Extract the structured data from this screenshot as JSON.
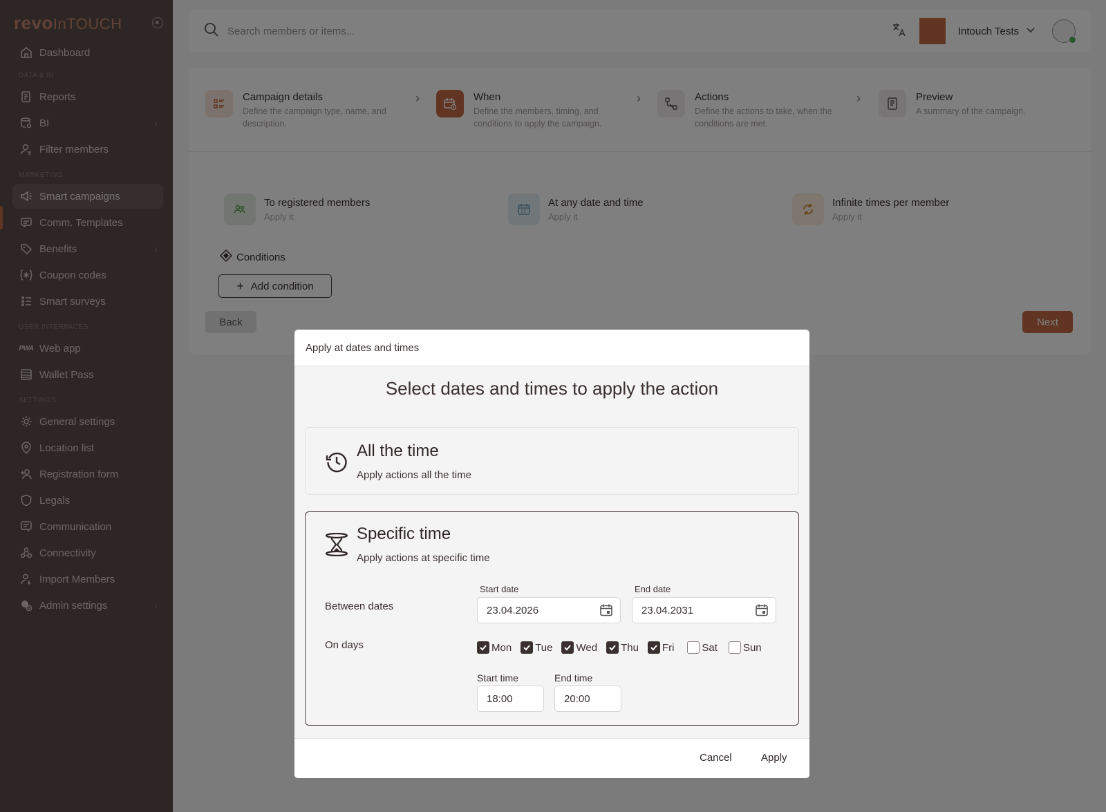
{
  "brand": {
    "logo_bold": "revo",
    "logo_light": "InTOUCH"
  },
  "sidebar": {
    "top": {
      "label": "Dashboard",
      "icon": "home-icon"
    },
    "sections": [
      {
        "title": "DATA & BI",
        "items": [
          {
            "label": "Reports",
            "icon": "reports-icon"
          },
          {
            "label": "BI",
            "icon": "bi-icon",
            "chevron": true
          },
          {
            "label": "Filter members",
            "icon": "user-filter-icon"
          }
        ]
      },
      {
        "title": "MARKETING",
        "items": [
          {
            "label": "Smart campaigns",
            "icon": "megaphone-icon",
            "active": true
          },
          {
            "label": "Comm. Templates",
            "icon": "message-icon"
          },
          {
            "label": "Benefits",
            "icon": "tag-icon",
            "chevron": true
          },
          {
            "label": "Coupon codes",
            "icon": "coupon-icon"
          },
          {
            "label": "Smart surveys",
            "icon": "survey-icon"
          }
        ]
      },
      {
        "title": "USER INTERFACES",
        "items": [
          {
            "label": "Web app",
            "icon": "pwa-icon"
          },
          {
            "label": "Wallet Pass",
            "icon": "wallet-icon"
          }
        ]
      },
      {
        "title": "SETTINGS",
        "items": [
          {
            "label": "General settings",
            "icon": "gear-icon"
          },
          {
            "label": "Location list",
            "icon": "location-pin-icon"
          },
          {
            "label": "Registration form",
            "icon": "user-add-icon"
          },
          {
            "label": "Legals",
            "icon": "shield-icon"
          },
          {
            "label": "Communication",
            "icon": "chat-icon"
          },
          {
            "label": "Connectivity",
            "icon": "connectivity-icon"
          },
          {
            "label": "Import Members",
            "icon": "import-user-icon"
          },
          {
            "label": "Admin settings",
            "icon": "admin-gear-icon",
            "chevron": true
          }
        ]
      }
    ]
  },
  "topbar": {
    "search_placeholder": "Search members or items...",
    "org_name": "Intouch Tests"
  },
  "steps": [
    {
      "title": "Campaign details",
      "desc": "Define the campaign type, name, and description.",
      "icon": "list-icon",
      "state": "done"
    },
    {
      "title": "When",
      "desc": "Define the members, timing, and conditions to apply the campaign.",
      "icon": "calendar-clock-icon",
      "state": "active"
    },
    {
      "title": "Actions",
      "desc": "Define the actions to take, when the conditions are met.",
      "icon": "actions-icon",
      "state": "pending"
    },
    {
      "title": "Preview",
      "desc": "A summary of the campaign.",
      "icon": "document-icon",
      "state": "pending"
    }
  ],
  "summary": [
    {
      "title": "To registered members",
      "sub": "Apply it",
      "icon": "members-icon",
      "color": "#e3efe0",
      "fg": "#5a9a4f"
    },
    {
      "title": "At any date and time",
      "sub": "Apply it",
      "icon": "calendar-icon",
      "color": "#e3eef3",
      "fg": "#6a9ab5"
    },
    {
      "title": "Infinite times per member",
      "sub": "Apply it",
      "icon": "repeat-icon",
      "color": "#fbeee0",
      "fg": "#d48a2c"
    }
  ],
  "conditions": {
    "label": "Conditions",
    "add_label": "Add condition"
  },
  "nav_buttons": {
    "back": "Back",
    "next": "Next"
  },
  "modal": {
    "header": "Apply at dates and times",
    "heading": "Select dates and times to apply the action",
    "all_time": {
      "title": "All the time",
      "sub": "Apply actions all the time"
    },
    "specific": {
      "title": "Specific time",
      "sub": "Apply actions at specific time",
      "between_label": "Between dates",
      "start_date_label": "Start date",
      "start_date": "23.04.2026",
      "end_date_label": "End date",
      "end_date": "23.04.2031",
      "days_label": "On days",
      "days": [
        {
          "label": "Mon",
          "checked": true
        },
        {
          "label": "Tue",
          "checked": true
        },
        {
          "label": "Wed",
          "checked": true
        },
        {
          "label": "Thu",
          "checked": true
        },
        {
          "label": "Fri",
          "checked": true
        },
        {
          "label": "Sat",
          "checked": false
        },
        {
          "label": "Sun",
          "checked": false
        }
      ],
      "start_time_label": "Start time",
      "start_time": "18:00",
      "end_time_label": "End time",
      "end_time": "20:00"
    },
    "cancel": "Cancel",
    "apply": "Apply"
  },
  "colors": {
    "accent": "#c46a45",
    "sidebar_bg": "#5b4d4b",
    "text": "#3a3030"
  }
}
